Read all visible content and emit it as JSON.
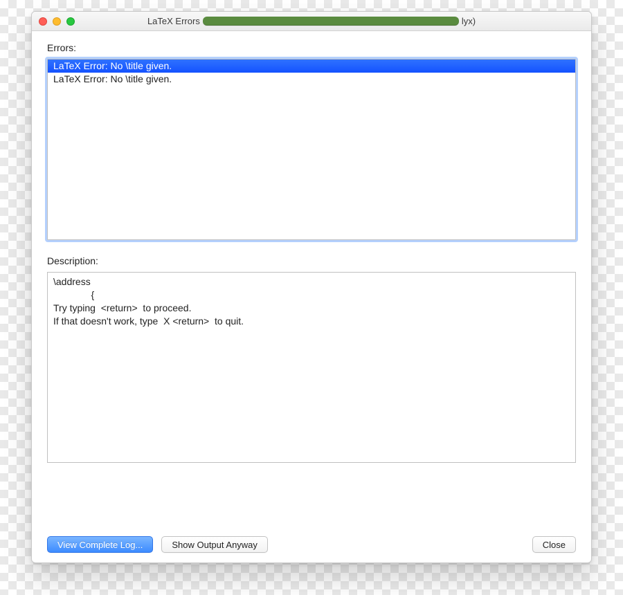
{
  "titlebar": {
    "prefix": "LaTeX Errors",
    "suffix": "lyx)"
  },
  "labels": {
    "errors": "Errors:",
    "description": "Description:"
  },
  "errors_list": [
    {
      "text": "LaTeX Error: No \\title given.",
      "selected": true
    },
    {
      "text": "LaTeX Error: No \\title given.",
      "selected": false
    }
  ],
  "description_text": "\\address\n              {\nTry typing  <return>  to proceed.\nIf that doesn't work, type  X <return>  to quit.",
  "buttons": {
    "view_log": "View Complete Log...",
    "show_anyway": "Show Output Anyway",
    "close": "Close"
  }
}
